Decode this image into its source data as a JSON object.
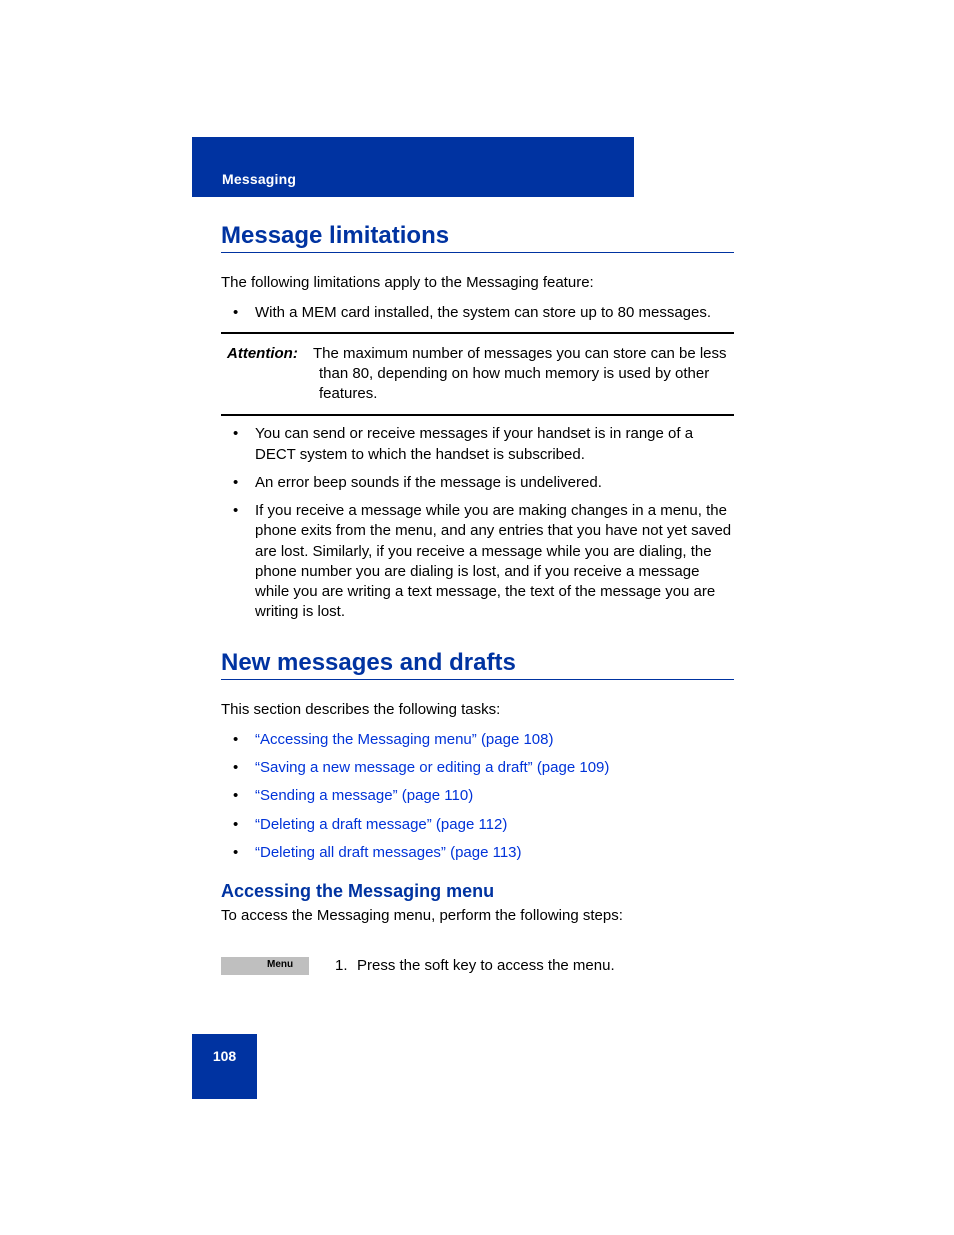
{
  "header": {
    "section": "Messaging"
  },
  "section1": {
    "title": "Message limitations",
    "intro": "The following limitations apply to the Messaging feature:",
    "bullets_a": [
      "With a MEM card installed, the system can store up to 80 messages."
    ],
    "attention_label": "Attention:",
    "attention_text": "The maximum number of messages you can store can be less than 80, depending on how much memory is used by other features.",
    "bullets_b": [
      "You can send or receive messages if your handset is in range of a DECT system to which the handset is subscribed.",
      "An error beep sounds if the message is undelivered.",
      "If you receive a message while you are making changes in a menu, the phone exits from the menu, and any entries that you have not yet saved are lost. Similarly, if you receive a message while you are dialing, the phone number you are dialing is lost, and if you receive a message while you are writing a text message, the text of the message you are writing is lost."
    ]
  },
  "section2": {
    "title": "New messages and drafts",
    "intro": "This section describes the following tasks:",
    "links": [
      "“Accessing the Messaging menu” (page 108)",
      "“Saving a new message or editing a draft” (page 109)",
      "“Sending a message” (page 110)",
      "“Deleting a draft message” (page 112)",
      "“Deleting all draft messages” (page 113)"
    ]
  },
  "subsection": {
    "title": "Accessing the Messaging menu",
    "intro": "To access the Messaging menu, perform the following steps:",
    "softkey_label": "Menu",
    "step_num": "1.",
    "step_text": "Press the            soft key to access the            menu."
  },
  "page_number": "108"
}
